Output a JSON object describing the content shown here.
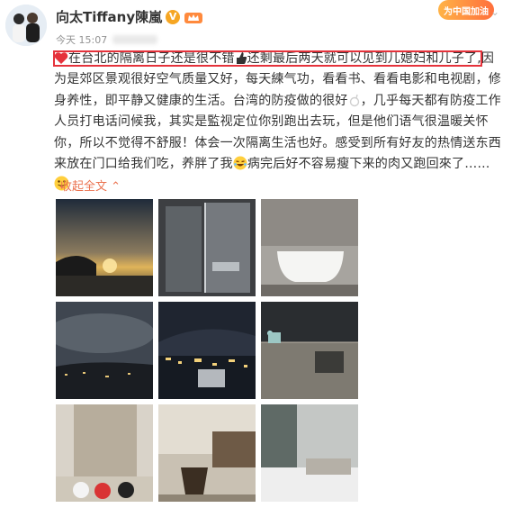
{
  "post": {
    "author": {
      "name": "向太Tiffany陳嵐",
      "verified_badge": "V",
      "level_icon": "crown-icon"
    },
    "time": "今天 15:07",
    "topic_badge": "为中国加油",
    "text": {
      "highlighted": "在台北的隔离日子还是很不错",
      "highlighted_2": "还剩最后两天就可以见到儿媳妇和儿子了,",
      "line_rest": "因为是郊区景观很好空气质量又好，每天練气功，看看书、看看电影和电视剧，修身养性，即平静又健康的生活。台湾的防疫做的很好",
      "part2": "，几乎每天都有防疫工作人员打电话问候我，其实是監视定位你别跑出去玩，但是他们语气很温暖关怀你，所以不觉得不舒服！体会一次隔离生活也好。感受到所有好友的热情送东西来放在门口给我们吃，养胖了我",
      "part3": "病完后好不容易瘦下来的肉又跑回來了……"
    },
    "collapse_label": "收起全文",
    "collapse_icon": "chevron-up-icon",
    "photos": [
      {
        "name": "photo-sunset-bay"
      },
      {
        "name": "photo-glass-shower"
      },
      {
        "name": "photo-bathtub"
      },
      {
        "name": "photo-night-clouds"
      },
      {
        "name": "photo-night-city-lights"
      },
      {
        "name": "photo-balcony-terrace"
      },
      {
        "name": "photo-living-room-chairs"
      },
      {
        "name": "photo-dining-lounge"
      },
      {
        "name": "photo-bedroom-window"
      }
    ]
  },
  "colors": {
    "highlight_box": "#e5323b",
    "link_orange": "#eb7350",
    "verified_gold": "#f6a623"
  }
}
